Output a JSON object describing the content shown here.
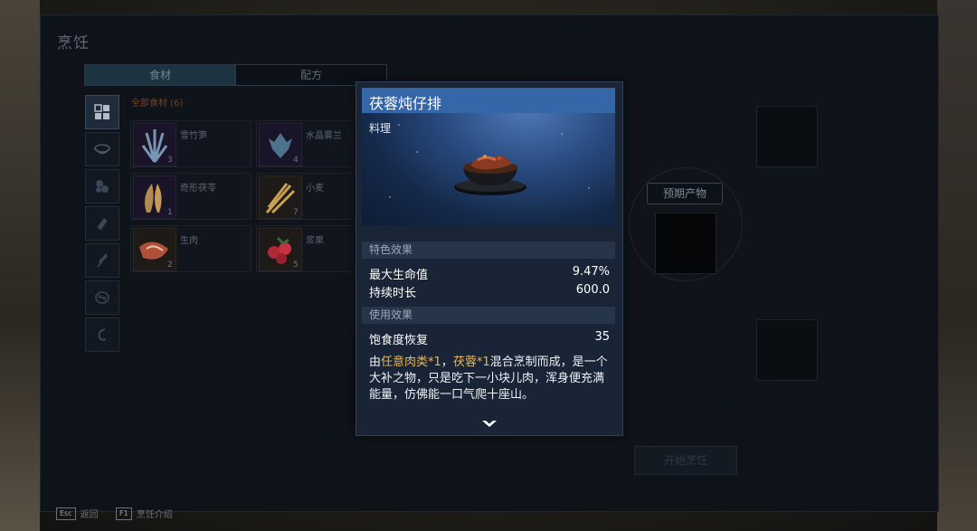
{
  "window": {
    "title": "烹饪"
  },
  "tabs": [
    {
      "label": "食材"
    },
    {
      "label": "配方"
    }
  ],
  "filter": {
    "label": "全部食材 (6)"
  },
  "ingredients": [
    {
      "name": "雪竹笋",
      "qty": "3"
    },
    {
      "name": "水晶雾兰",
      "qty": "4"
    },
    {
      "name": "奇形茯苓",
      "qty": "1"
    },
    {
      "name": "小麦",
      "qty": "7"
    },
    {
      "name": "生肉",
      "qty": "2"
    },
    {
      "name": "浆果",
      "qty": "5"
    }
  ],
  "tooltip": {
    "name": "茯蓉炖仔排",
    "type": "料理",
    "special_header": "特色效果",
    "special_stats": [
      {
        "label": "最大生命值",
        "value": "9.47%"
      },
      {
        "label": "持续时长",
        "value": "600.0"
      }
    ],
    "use_header": "使用效果",
    "use_stats": [
      {
        "label": "饱食度恢复",
        "value": "35"
      }
    ],
    "desc": {
      "p1": "由",
      "h1": "任意肉类*1",
      "p2": "，",
      "h2": "茯蓉*1",
      "p3": "混合烹制而成，是一个大补之物，只是吃下一小块儿肉，浑身便充满能量，仿佛能一口气爬十座山。"
    }
  },
  "output": {
    "label": "预期产物"
  },
  "cook_button": {
    "label": "开始烹饪"
  },
  "footer": {
    "back_key": "Esc",
    "back_label": "返回",
    "help_key": "F1",
    "help_label": "烹饪介绍"
  }
}
